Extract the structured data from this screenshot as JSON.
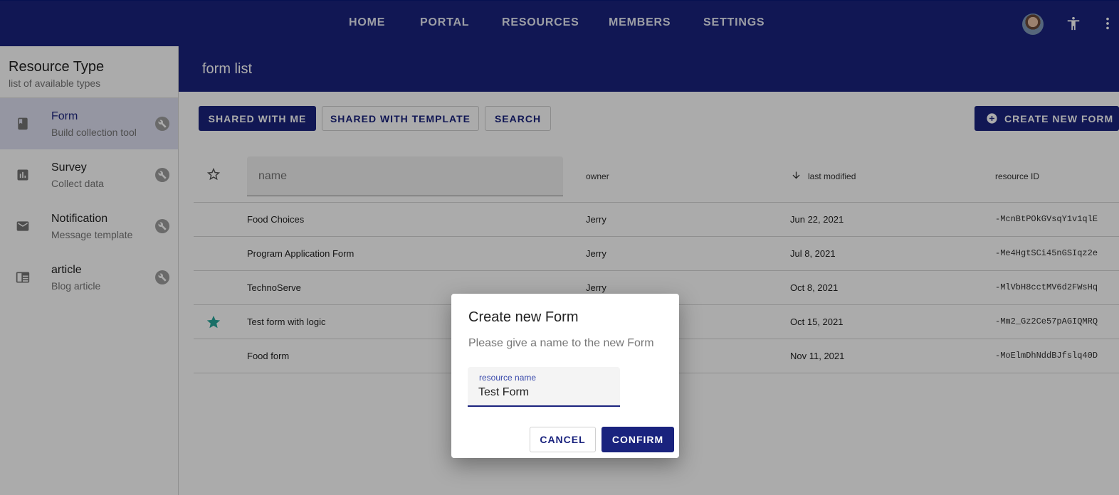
{
  "nav": {
    "items": [
      "HOME",
      "PORTAL",
      "RESOURCES",
      "MEMBERS",
      "SETTINGS"
    ]
  },
  "sidebar": {
    "title": "Resource Type",
    "subtitle": "list of available types",
    "items": [
      {
        "label": "Form",
        "desc": "Build collection tool",
        "icon": "book-icon",
        "active": true
      },
      {
        "label": "Survey",
        "desc": "Collect data",
        "icon": "bar-chart-icon"
      },
      {
        "label": "Notification",
        "desc": "Message template",
        "icon": "mail-icon"
      },
      {
        "label": "article",
        "desc": "Blog article",
        "icon": "article-icon"
      }
    ]
  },
  "main": {
    "title": "form list",
    "filters": [
      "SHARED WITH ME",
      "SHARED WITH TEMPLATE",
      "SEARCH"
    ],
    "create_label": "CREATE NEW FORM"
  },
  "table": {
    "name_placeholder": "name",
    "columns": {
      "owner": "owner",
      "last_modified": "last modified",
      "resource_id": "resource ID"
    },
    "rows": [
      {
        "name": "Food Choices",
        "owner": "Jerry",
        "modified": "Jun 22, 2021",
        "id": "-McnBtPOkGVsqY1v1qlE",
        "starred": false
      },
      {
        "name": "Program Application Form",
        "owner": "Jerry",
        "modified": "Jul 8, 2021",
        "id": "-Me4HgtSCi45nGSIqz2e",
        "starred": false
      },
      {
        "name": "TechnoServe",
        "owner": "Jerry",
        "modified": "Oct 8, 2021",
        "id": "-MlVbH8cctMV6d2FWsHq",
        "starred": false
      },
      {
        "name": "Test form with logic",
        "owner": "",
        "modified": "Oct 15, 2021",
        "id": "-Mm2_Gz2Ce57pAGIQMRQ",
        "starred": true
      },
      {
        "name": "Food form",
        "owner": "",
        "modified": "Nov 11, 2021",
        "id": "-MoElmDhNddBJfslq40D",
        "starred": false
      }
    ]
  },
  "dialog": {
    "title": "Create new Form",
    "message": "Please give a name to the new Form",
    "field_label": "resource name",
    "field_value": "Test Form",
    "cancel": "CANCEL",
    "confirm": "CONFIRM"
  },
  "colors": {
    "primary": "#1a237e",
    "star_active": "#26a69a"
  }
}
